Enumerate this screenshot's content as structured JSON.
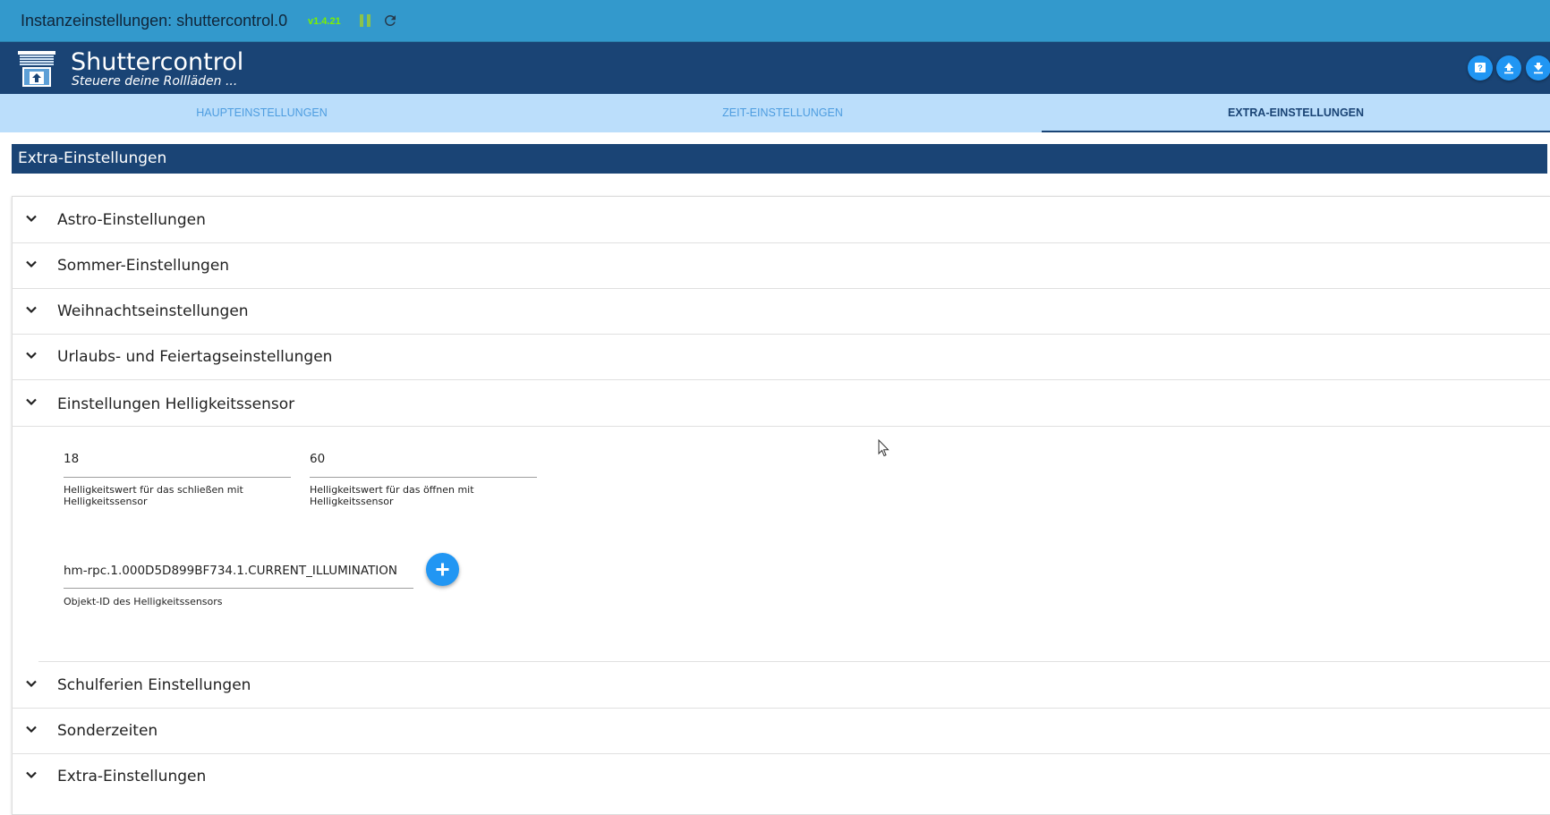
{
  "instance_bar": {
    "title": "Instanzeinstellungen: shuttercontrol.0",
    "version": "v1.4.21"
  },
  "header": {
    "app_name": "Shuttercontrol",
    "subtitle": "Steuere deine Rollläden ..."
  },
  "tabs": [
    {
      "label": "HAUPTEINSTELLUNGEN",
      "active": false
    },
    {
      "label": "ZEIT-EINSTELLUNGEN",
      "active": false
    },
    {
      "label": "EXTRA-EINSTELLUNGEN",
      "active": true
    }
  ],
  "section_title": "Extra-Einstellungen",
  "accordion": {
    "items": [
      {
        "label": "Astro-Einstellungen",
        "expanded": false
      },
      {
        "label": "Sommer-Einstellungen",
        "expanded": false
      },
      {
        "label": "Weihnachtseinstellungen",
        "expanded": false
      },
      {
        "label": "Urlaubs- und Feiertagseinstellungen",
        "expanded": false
      },
      {
        "label": "Einstellungen Helligkeitssensor",
        "expanded": true
      },
      {
        "label": "Schulferien Einstellungen",
        "expanded": false
      },
      {
        "label": "Sonderzeiten",
        "expanded": false
      },
      {
        "label": "Extra-Einstellungen",
        "expanded": false
      }
    ]
  },
  "brightness": {
    "close_value": "18",
    "close_help": "Helligkeitswert für das schließen mit Helligkeitssensor",
    "open_value": "60",
    "open_help": "Helligkeitswert für das öffnen mit Helligkeitssensor",
    "object_id": "hm-rpc.1.000D5D899BF734.1.CURRENT_ILLUMINATION",
    "object_id_help": "Objekt-ID des Helligkeitssensors"
  },
  "colors": {
    "topbar": "#3399cc",
    "header": "#1a4475",
    "tabs": "#bbdefb",
    "accent": "#2196f3"
  },
  "icons": [
    "pause-icon",
    "reload-icon",
    "help-icon",
    "upload-icon",
    "download-icon",
    "chevron-down-icon",
    "plus-icon"
  ]
}
